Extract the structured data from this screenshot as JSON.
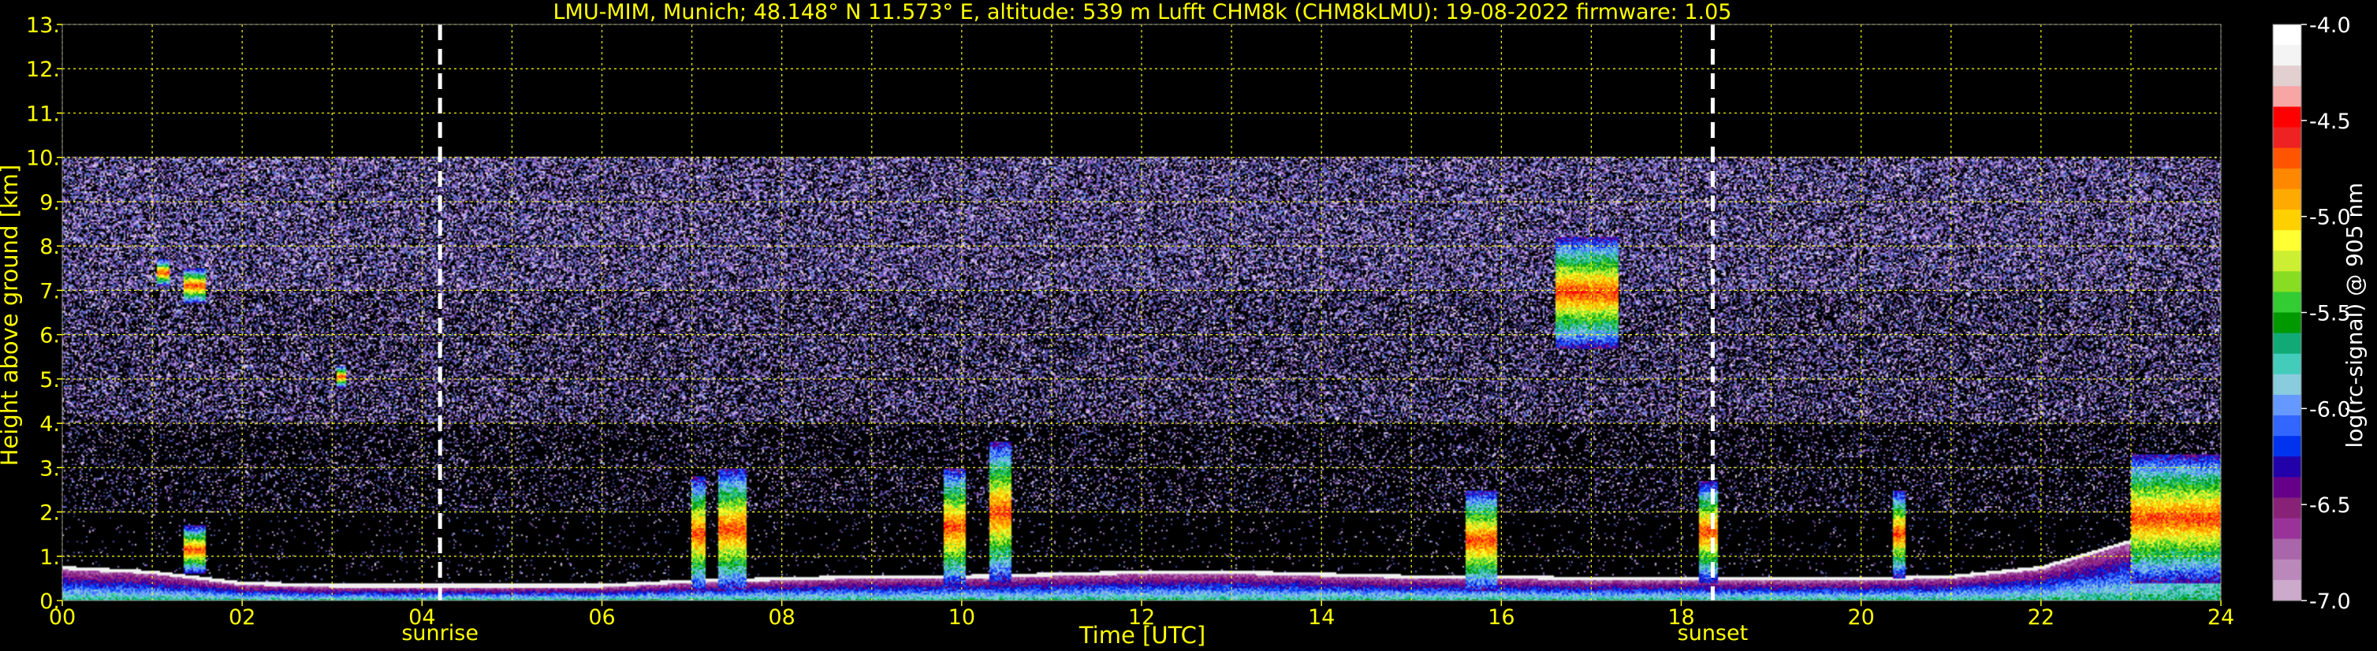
{
  "chart_data": {
    "type": "heatmap",
    "title": "LMU-MIM, Munich; 48.148° N 11.573° E, altitude: 539 m    Lufft CHM8k (CHM8kLMU): 19-08-2022    firmware: 1.05",
    "xlabel": "Time [UTC]",
    "ylabel": "Height above ground [km]",
    "xlim": [
      0,
      24
    ],
    "ylim": [
      0,
      13
    ],
    "x_tick_labels": [
      "00",
      "02",
      "04",
      "06",
      "08",
      "10",
      "12",
      "14",
      "16",
      "18",
      "20",
      "22",
      "24"
    ],
    "y_tick_labels": [
      "0.",
      "1.",
      "2.",
      "3.",
      "4.",
      "5.",
      "6.",
      "7.",
      "8.",
      "9.",
      "10.",
      "11.",
      "12.",
      "13."
    ],
    "grid": true,
    "grid_color": "#ffff00",
    "measurement_ceiling_km": 10,
    "markers": [
      {
        "name": "sunrise",
        "time": 4.2
      },
      {
        "name": "sunset",
        "time": 18.35
      }
    ],
    "colorbar": {
      "label": "log(rc-signal) @ 905 nm",
      "range": [
        -7.0,
        -4.0
      ],
      "tick_labels": [
        "-4.0",
        "-4.5",
        "-5.0",
        "-5.5",
        "-6.0",
        "-6.5",
        "-7.0"
      ],
      "colors": [
        "#ffffff",
        "#f4f4f4",
        "#e2cfcf",
        "#f7a5a5",
        "#ff0000",
        "#ee2222",
        "#ff5500",
        "#ff8800",
        "#ffaa00",
        "#ffd000",
        "#ffff33",
        "#ccee33",
        "#88dd22",
        "#33cc33",
        "#009900",
        "#11aa77",
        "#44ccbb",
        "#88ccdd",
        "#6699ff",
        "#3366ff",
        "#0033ee",
        "#2200aa",
        "#660088",
        "#882277",
        "#993399",
        "#aa66aa",
        "#bb88bb",
        "#ccaacc"
      ]
    },
    "features": [
      {
        "kind": "boundary_layer",
        "times": [
          0,
          1,
          2,
          3,
          4,
          5,
          6,
          7,
          8,
          9,
          10,
          11,
          12,
          13,
          14,
          15,
          16,
          17,
          18,
          19,
          20,
          21,
          22,
          23,
          24
        ],
        "heights_km": [
          0.7,
          0.6,
          0.35,
          0.3,
          0.3,
          0.3,
          0.3,
          0.4,
          0.45,
          0.5,
          0.5,
          0.55,
          0.6,
          0.6,
          0.55,
          0.5,
          0.5,
          0.45,
          0.45,
          0.45,
          0.45,
          0.5,
          0.7,
          1.3,
          2.8
        ]
      },
      {
        "kind": "cloud",
        "t0": 1.05,
        "t1": 1.2,
        "h0": 7.1,
        "h1": 7.7
      },
      {
        "kind": "cloud",
        "t0": 1.35,
        "t1": 1.6,
        "h0": 6.7,
        "h1": 7.5
      },
      {
        "kind": "cloud",
        "t0": 3.05,
        "t1": 3.15,
        "h0": 4.8,
        "h1": 5.3
      },
      {
        "kind": "cloud",
        "t0": 1.35,
        "t1": 1.6,
        "h0": 0.6,
        "h1": 1.7
      },
      {
        "kind": "cloud",
        "t0": 7.0,
        "t1": 7.15,
        "h0": 0.2,
        "h1": 2.8
      },
      {
        "kind": "cloud",
        "t0": 7.3,
        "t1": 7.6,
        "h0": 0.2,
        "h1": 3.0
      },
      {
        "kind": "cloud",
        "t0": 9.8,
        "t1": 10.05,
        "h0": 0.3,
        "h1": 3.0
      },
      {
        "kind": "cloud",
        "t0": 10.3,
        "t1": 10.55,
        "h0": 0.4,
        "h1": 3.6
      },
      {
        "kind": "cloud",
        "t0": 15.6,
        "t1": 15.95,
        "h0": 0.2,
        "h1": 2.5
      },
      {
        "kind": "cloud",
        "t0": 18.2,
        "t1": 18.4,
        "h0": 0.4,
        "h1": 2.7
      },
      {
        "kind": "cloud",
        "t0": 20.35,
        "t1": 20.5,
        "h0": 0.5,
        "h1": 2.5
      },
      {
        "kind": "cloud",
        "t0": 23.0,
        "t1": 24.0,
        "h0": 0.4,
        "h1": 3.3
      },
      {
        "kind": "cloud",
        "t0": 16.6,
        "t1": 17.3,
        "h0": 5.7,
        "h1": 8.2
      }
    ]
  }
}
